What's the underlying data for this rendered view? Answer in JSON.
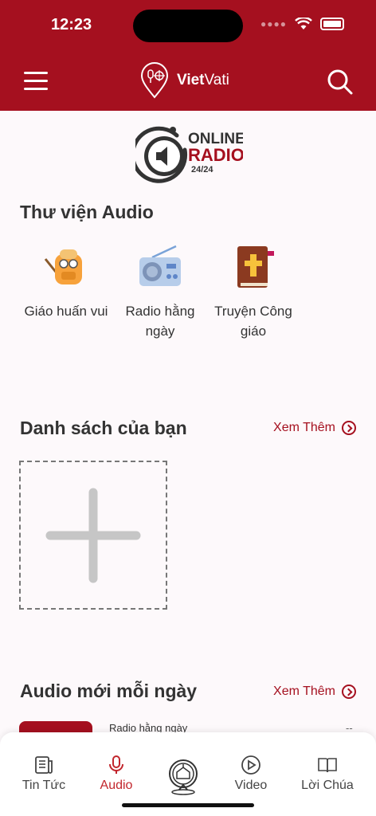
{
  "status_bar": {
    "time": "12:23"
  },
  "header": {
    "brand_bold": "Viet",
    "brand_rest": "Vati"
  },
  "radio_logo": {
    "line1": "ONLINE",
    "line2": "RADIO",
    "line3": "24/24"
  },
  "library": {
    "title": "Thư viện Audio",
    "items": [
      {
        "label": "Giáo huấn vui",
        "icon": "backpack-icon"
      },
      {
        "label": "Radio hằng ngày",
        "icon": "radio-icon"
      },
      {
        "label": "Truyện Công giáo",
        "icon": "bible-icon"
      }
    ]
  },
  "playlist": {
    "title": "Danh sách của bạn",
    "more_label": "Xem Thêm"
  },
  "daily": {
    "title": "Audio mới mỗi ngày",
    "more_label": "Xem Thêm",
    "first_item_category": "Radio hằng ngày",
    "first_item_meta": "--"
  },
  "tabs": [
    {
      "label": "Tin Tức",
      "icon": "news-icon"
    },
    {
      "label": "Audio",
      "icon": "microphone-icon"
    },
    {
      "label": "",
      "icon": "church-pin-icon"
    },
    {
      "label": "Video",
      "icon": "play-circle-icon"
    },
    {
      "label": "Lời Chúa",
      "icon": "book-icon"
    }
  ],
  "colors": {
    "brand": "#a5101f",
    "accent": "#c2262d"
  }
}
